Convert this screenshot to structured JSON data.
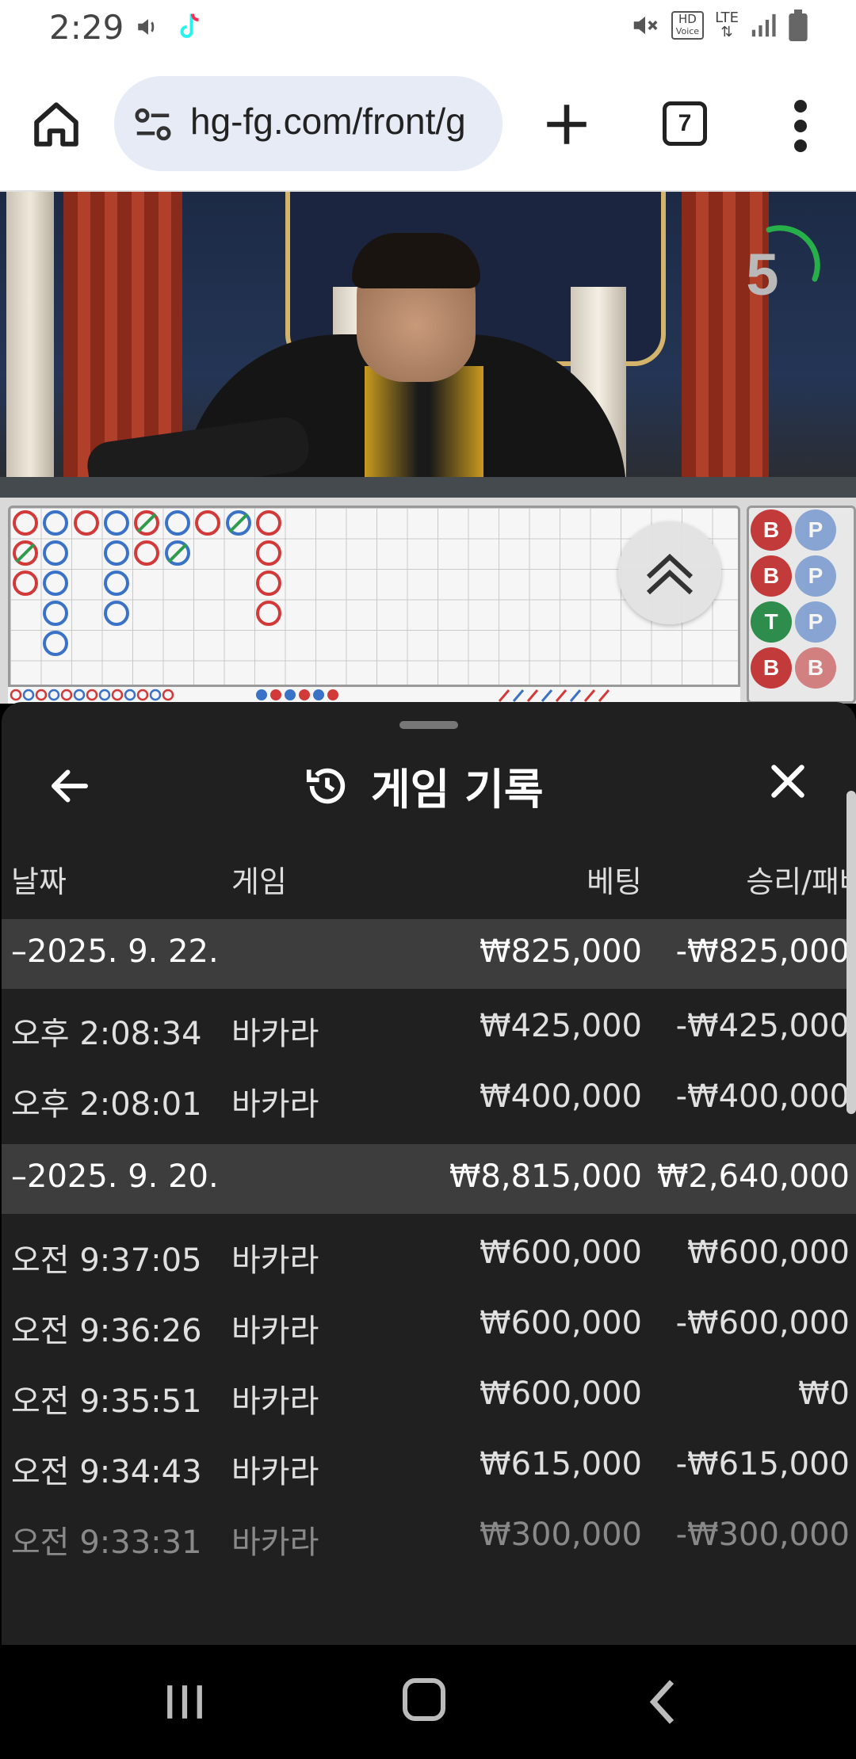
{
  "status_bar": {
    "time": "2:29",
    "hd_label": "HD",
    "voice_label": "Voice",
    "lte_label": "LTE",
    "icons": [
      "volume-icon",
      "tiktok-icon",
      "mute-icon",
      "signal-icon",
      "battery-icon"
    ]
  },
  "browser": {
    "url": "hg-fg.com/front/g",
    "tab_count": "7"
  },
  "video": {
    "countdown": "5"
  },
  "roadmap": {
    "beads": [
      "B",
      "P",
      "B",
      "P",
      "T",
      "P",
      "B",
      "B"
    ]
  },
  "history": {
    "title": "게임 기록",
    "columns": {
      "date": "날짜",
      "game": "게임",
      "bet": "베팅",
      "win_loss": "승리/패배"
    },
    "groups": [
      {
        "date": "–2025. 9. 22.",
        "bet": "₩825,000",
        "win_loss": "-₩825,000",
        "rows": [
          {
            "time": "오후 2:08:34",
            "game": "바카라",
            "bet": "₩425,000",
            "win_loss": "-₩425,000"
          },
          {
            "time": "오후 2:08:01",
            "game": "바카라",
            "bet": "₩400,000",
            "win_loss": "-₩400,000"
          }
        ]
      },
      {
        "date": "–2025. 9. 20.",
        "bet": "₩8,815,000",
        "win_loss": "₩2,640,000",
        "rows": [
          {
            "time": "오전 9:37:05",
            "game": "바카라",
            "bet": "₩600,000",
            "win_loss": "₩600,000"
          },
          {
            "time": "오전 9:36:26",
            "game": "바카라",
            "bet": "₩600,000",
            "win_loss": "-₩600,000"
          },
          {
            "time": "오전 9:35:51",
            "game": "바카라",
            "bet": "₩600,000",
            "win_loss": "₩0"
          },
          {
            "time": "오전 9:34:43",
            "game": "바카라",
            "bet": "₩615,000",
            "win_loss": "-₩615,000"
          },
          {
            "time": "오전 9:33:31",
            "game": "바카라",
            "bet": "₩300,000",
            "win_loss": "-₩300,000"
          }
        ]
      }
    ]
  },
  "colors": {
    "sheet_bg": "#202020",
    "group_bg": "#3d3d3d",
    "banker_red": "#c33a3a",
    "player_blue": "#4a78c4",
    "tie_green": "#2e8c4c"
  }
}
